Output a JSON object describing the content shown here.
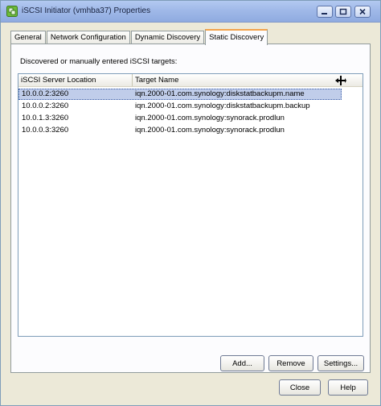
{
  "window": {
    "title": "iSCSI Initiator (vmhba37) Properties"
  },
  "tabs": [
    {
      "label": "General"
    },
    {
      "label": "Network Configuration"
    },
    {
      "label": "Dynamic Discovery"
    },
    {
      "label": "Static Discovery",
      "active": true
    }
  ],
  "static_discovery": {
    "description": "Discovered or manually entered iSCSI targets:",
    "columns": [
      "iSCSI Server Location",
      "Target Name"
    ],
    "rows": [
      {
        "location": "10.0.0.2:3260",
        "target": "iqn.2000-01.com.synology:diskstatbackupm.name",
        "selected": true
      },
      {
        "location": "10.0.0.2:3260",
        "target": "iqn.2000-01.com.synology:diskstatbackupm.backup"
      },
      {
        "location": "10.0.1.3:3260",
        "target": "iqn.2000-01.com.synology:synorack.prodlun"
      },
      {
        "location": "10.0.0.3:3260",
        "target": "iqn.2000-01.com.synology:synorack.prodlun"
      }
    ],
    "buttons": {
      "add": "Add...",
      "remove": "Remove",
      "settings": "Settings..."
    }
  },
  "footer": {
    "close": "Close",
    "help": "Help"
  },
  "colors": {
    "selection": "#c0cdea",
    "active_tab_accent": "#f3a34b",
    "titlebar": "#a0b9e8"
  }
}
